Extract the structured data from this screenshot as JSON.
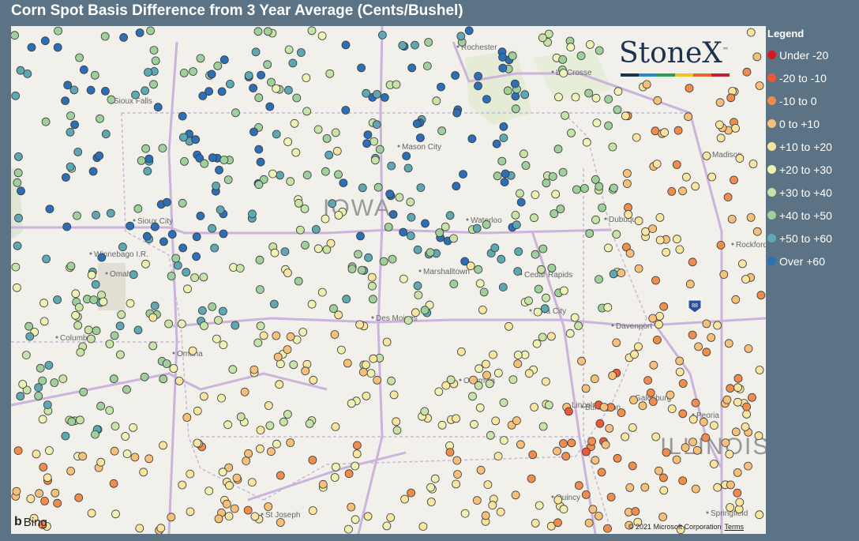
{
  "title": "Corn Spot Basis Difference from 3 Year Average (Cents/Bushel)",
  "logo": {
    "text": "StoneX",
    "trademark": "™",
    "bar_colors": [
      "#1c3250",
      "#2a8ac8",
      "#2e9e4e",
      "#f2c21e",
      "#e8652b",
      "#c8202e"
    ]
  },
  "legend": {
    "title": "Legend",
    "items": [
      {
        "label": "Under -20",
        "color": "#d7191c"
      },
      {
        "label": "-20 to -10",
        "color": "#e85b3a"
      },
      {
        "label": "-10 to 0",
        "color": "#f08c4c"
      },
      {
        "label": "0 to +10",
        "color": "#f6c07a"
      },
      {
        "label": "+10 to +20",
        "color": "#fae5a0"
      },
      {
        "label": "+20 to +30",
        "color": "#eef3b4"
      },
      {
        "label": "+30 to +40",
        "color": "#c8e3a6"
      },
      {
        "label": "+40 to +50",
        "color": "#9fd09c"
      },
      {
        "label": "+50 to +60",
        "color": "#5ea8b4"
      },
      {
        "label": "Over +60",
        "color": "#2c6fb6"
      }
    ]
  },
  "map": {
    "state_labels": [
      "IOWA",
      "ILLINOIS"
    ],
    "city_labels": [
      "Rochester",
      "La Crosse",
      "Sioux Falls",
      "Mason City",
      "Madison",
      "Sioux City",
      "Waterloo",
      "Dubuque",
      "Winnebago I.R.",
      "Omaha",
      "Marshalltown",
      "Cedar Rapids",
      "Rockford",
      "Iowa City",
      "Davenport",
      "Columbus",
      "Des Moines",
      "Omaha",
      "Ottumwa",
      "Galesburg",
      "Lincoln",
      "Burlington",
      "Peoria",
      "Quincy",
      "St Joseph",
      "Springfield"
    ],
    "highway_shield": "88",
    "attribution": "© 2021 Microsoft Corporation",
    "terms": "Terms",
    "provider": "Bing"
  }
}
